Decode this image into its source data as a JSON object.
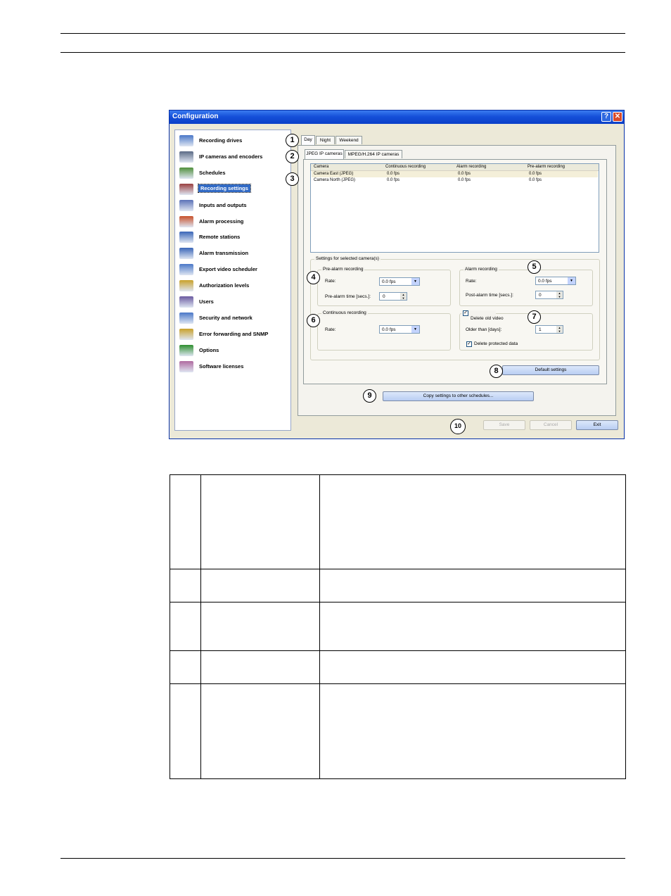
{
  "window": {
    "title": "Configuration",
    "help_label": "?",
    "close_label": "✕"
  },
  "sidebar": {
    "items": [
      {
        "label": "Recording drives",
        "icon": "drive-icon"
      },
      {
        "label": "IP cameras and encoders",
        "icon": "camera-icon"
      },
      {
        "label": "Schedules",
        "icon": "schedule-icon"
      },
      {
        "label": "Recording settings",
        "icon": "recording-icon",
        "selected": true
      },
      {
        "label": "Inputs and outputs",
        "icon": "io-icon"
      },
      {
        "label": "Alarm processing",
        "icon": "alarm-icon"
      },
      {
        "label": "Remote stations",
        "icon": "monitor-icon"
      },
      {
        "label": "Alarm transmission",
        "icon": "network-icon"
      },
      {
        "label": "Export video scheduler",
        "icon": "export-icon"
      },
      {
        "label": "Authorization levels",
        "icon": "key-icon"
      },
      {
        "label": "Users",
        "icon": "users-icon"
      },
      {
        "label": "Security and network",
        "icon": "lock-icon"
      },
      {
        "label": "Error forwarding and SNMP",
        "icon": "warning-icon"
      },
      {
        "label": "Options",
        "icon": "checkmark-icon"
      },
      {
        "label": "Software licenses",
        "icon": "license-icon"
      }
    ]
  },
  "schedule_tabs": [
    "Day",
    "Night",
    "Weekend"
  ],
  "camera_tabs": [
    "JPEG IP cameras",
    "MPEG/H.264 IP cameras"
  ],
  "camera_table": {
    "headers": [
      "Camera",
      "Continuous recording",
      "Alarm recording",
      "Pre-alarm recording"
    ],
    "rows": [
      [
        "Camera East (JPEG)",
        "0.0 fps",
        "0.0 fps",
        "0.0 fps"
      ],
      [
        "Camera North (JPEG)",
        "0.0 fps",
        "0.0 fps",
        "0.0 fps"
      ]
    ]
  },
  "settings": {
    "group_title": "Settings for selected camera(s)",
    "pre_alarm": {
      "title": "Pre-alarm recording",
      "rate_label": "Rate:",
      "rate_value": "0.0 fps",
      "time_label": "Pre-alarm time [secs.]:",
      "time_value": "0"
    },
    "alarm": {
      "title": "Alarm recording",
      "rate_label": "Rate:",
      "rate_value": "0.0 fps",
      "time_label": "Post-alarm time [secs.]:",
      "time_value": "0"
    },
    "continuous": {
      "title": "Continuous recording",
      "rate_label": "Rate:",
      "rate_value": "0.0 fps"
    },
    "delete_old": {
      "title": "Delete old video",
      "checked": true,
      "older_label": "Older than [days]:",
      "older_value": "1",
      "protected_label": "Delete protected data",
      "protected_checked": true
    }
  },
  "buttons": {
    "default_settings": "Default settings",
    "copy_settings": "Copy settings to other schedules...",
    "save": "Save",
    "cancel": "Cancel",
    "exit": "Exit"
  },
  "callouts": [
    "1",
    "2",
    "3",
    "4",
    "5",
    "6",
    "7",
    "8",
    "9",
    "10"
  ],
  "colors": {
    "titlebar": "#1550d9",
    "selection": "#316ac5",
    "dialog_bg": "#ece9d8"
  }
}
